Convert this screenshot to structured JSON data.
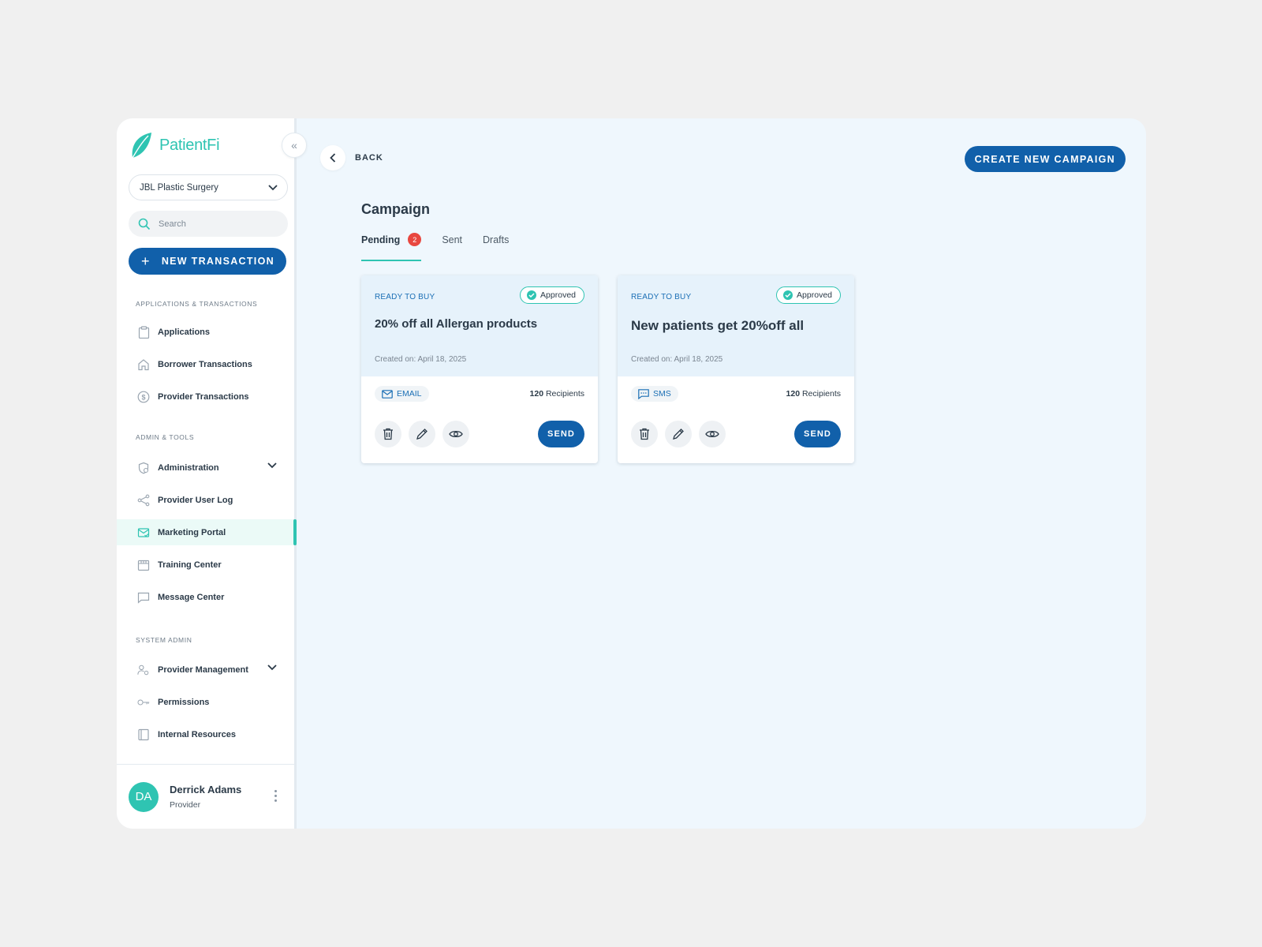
{
  "brand": {
    "name": "PatientFi",
    "accent": "#2fc4b2",
    "primary": "#1160aa"
  },
  "sidebar": {
    "org_select": "JBL Plastic Surgery",
    "search_placeholder": "Search",
    "new_transaction_label": "NEW TRANSACTION",
    "sections": [
      {
        "title": "APPLICATIONS & TRANSACTIONS"
      },
      {
        "title": "ADMIN & TOOLS"
      },
      {
        "title": "SYSTEM ADMIN"
      }
    ],
    "items": [
      {
        "label": "Applications",
        "icon": "clipboard-icon"
      },
      {
        "label": "Borrower Transactions",
        "icon": "home-icon"
      },
      {
        "label": "Provider Transactions",
        "icon": "dollar-circle-icon"
      },
      {
        "label": "Administration",
        "icon": "shield-gear-icon"
      },
      {
        "label": "Provider User Log",
        "icon": "share-icon"
      },
      {
        "label": "Marketing Portal",
        "icon": "mail-check-icon"
      },
      {
        "label": "Training Center",
        "icon": "calendar-icon"
      },
      {
        "label": "Message Center",
        "icon": "chat-icon"
      },
      {
        "label": "Provider Management",
        "icon": "user-gear-icon"
      },
      {
        "label": "Permissions",
        "icon": "key-icon"
      },
      {
        "label": "Internal Resources",
        "icon": "book-icon"
      }
    ],
    "active_item": "Marketing Portal",
    "user": {
      "initials": "DA",
      "name": "Derrick Adams",
      "role": "Provider"
    }
  },
  "main": {
    "back_label": "BACK",
    "create_button": "CREATE NEW CAMPAIGN",
    "title": "Campaign",
    "tabs": [
      {
        "label": "Pending",
        "badge": "2",
        "active": true
      },
      {
        "label": "Sent"
      },
      {
        "label": "Drafts"
      }
    ],
    "cards": [
      {
        "type": "READY TO BUY",
        "status": "Approved",
        "title": "20% off all Allergan products",
        "created": "Created on: April 18, 2025",
        "channel": "EMAIL",
        "recipients_count": "120",
        "recipients_label": "Recipients",
        "send_label": "SEND"
      },
      {
        "type": "READY TO BUY",
        "status": "Approved",
        "title": "New patients get 20%off all",
        "created": "Created on: April 18, 2025",
        "channel": "SMS",
        "recipients_count": "120",
        "recipients_label": "Recipients",
        "send_label": "SEND"
      }
    ]
  }
}
